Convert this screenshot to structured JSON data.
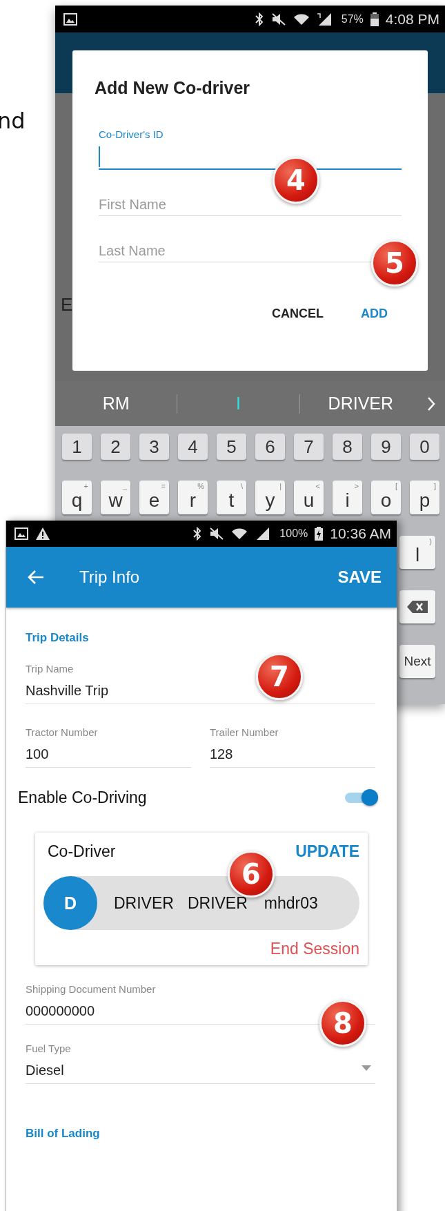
{
  "background_text": "nd",
  "back_phone": {
    "status_bar": {
      "battery": "57%",
      "time": "4:08 PM"
    },
    "peek_text": "E",
    "dialog": {
      "title": "Add New Co-driver",
      "fields": [
        {
          "label": "Co-Driver's ID",
          "focused": true
        },
        {
          "placeholder": "First Name",
          "focused": false
        },
        {
          "placeholder": "Last Name",
          "focused": false
        }
      ],
      "buttons": [
        {
          "label": "CANCEL",
          "primary": false
        },
        {
          "label": "ADD",
          "primary": true
        }
      ]
    },
    "keyboard": {
      "suggestions": [
        {
          "text": "RM",
          "typed": false
        },
        {
          "text": "I",
          "typed": true
        },
        {
          "text": "DRIVER",
          "typed": false
        }
      ],
      "number_row": [
        "1",
        "2",
        "3",
        "4",
        "5",
        "6",
        "7",
        "8",
        "9",
        "0"
      ],
      "letter_row": [
        {
          "label": "q",
          "alt": "+"
        },
        {
          "label": "w",
          "alt": "_"
        },
        {
          "label": "e",
          "alt": "="
        },
        {
          "label": "r",
          "alt": "%"
        },
        {
          "label": "t",
          "alt": "\\"
        },
        {
          "label": "y",
          "alt": "|"
        },
        {
          "label": "u",
          "alt": "<"
        },
        {
          "label": "i",
          "alt": ">"
        },
        {
          "label": "o",
          "alt": "["
        },
        {
          "label": "p",
          "alt": "]"
        }
      ],
      "side_keys": [
        {
          "kind": "letter",
          "label": "l",
          "alt": ")"
        },
        {
          "kind": "backspace"
        },
        {
          "kind": "text",
          "label": "Next"
        }
      ]
    }
  },
  "front_phone": {
    "status_bar": {
      "battery": "100%",
      "time": "10:36 AM"
    },
    "app_bar": {
      "title": "Trip Info",
      "action": "SAVE"
    },
    "section": "Trip Details",
    "trip_name": {
      "label": "Trip Name",
      "value": "Nashville Trip"
    },
    "numbers": [
      {
        "label": "Tractor Number",
        "value": "100"
      },
      {
        "label": "Trailer Number",
        "value": "128"
      }
    ],
    "co_driving": {
      "label": "Enable Co-Driving",
      "on": true
    },
    "co_driver": {
      "title": "Co-Driver",
      "action": "UPDATE",
      "initial": "D",
      "first_name": "DRIVER",
      "last_name": "DRIVER",
      "id": "mhdr03",
      "end": "End Session"
    },
    "shipping": {
      "label": "Shipping Document Number",
      "value": "000000000"
    },
    "fuel": {
      "label": "Fuel Type",
      "value": "Diesel"
    },
    "next_section": "Bill of Lading"
  },
  "callouts": [
    {
      "number": "4"
    },
    {
      "number": "5"
    },
    {
      "number": "6"
    },
    {
      "number": "7"
    },
    {
      "number": "8"
    }
  ]
}
